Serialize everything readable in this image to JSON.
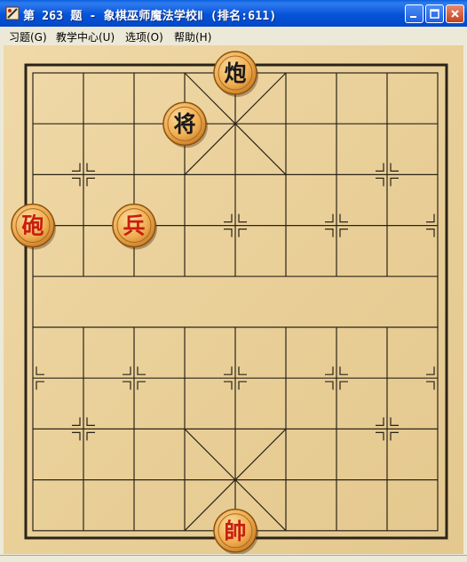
{
  "window": {
    "title": "第 263 题 - 象棋巫师魔法学校Ⅱ (排名:611)"
  },
  "menu": [
    {
      "label": "习题(G)"
    },
    {
      "label": "教学中心(U)"
    },
    {
      "label": "选项(O)"
    },
    {
      "label": "帮助(H)"
    }
  ],
  "icons": {
    "app": "chess-app-icon",
    "minimize": "minimize-icon",
    "maximize": "maximize-icon",
    "close": "close-icon"
  },
  "colors": {
    "red_piece_text": "#c81e10",
    "black_piece_text": "#1a1a1a",
    "board_line": "#2a2418"
  },
  "board": {
    "files": 9,
    "ranks": 10,
    "pieces": [
      {
        "name": "black-cannon",
        "side": "black",
        "char": "炮",
        "file": 4,
        "rank": 0
      },
      {
        "name": "black-general",
        "side": "black",
        "char": "将",
        "file": 3,
        "rank": 1
      },
      {
        "name": "red-cannon",
        "side": "red",
        "char": "砲",
        "file": 0,
        "rank": 3
      },
      {
        "name": "red-soldier",
        "side": "red",
        "char": "兵",
        "file": 2,
        "rank": 3
      },
      {
        "name": "red-king",
        "side": "red",
        "char": "帥",
        "file": 4,
        "rank": 9
      }
    ]
  }
}
